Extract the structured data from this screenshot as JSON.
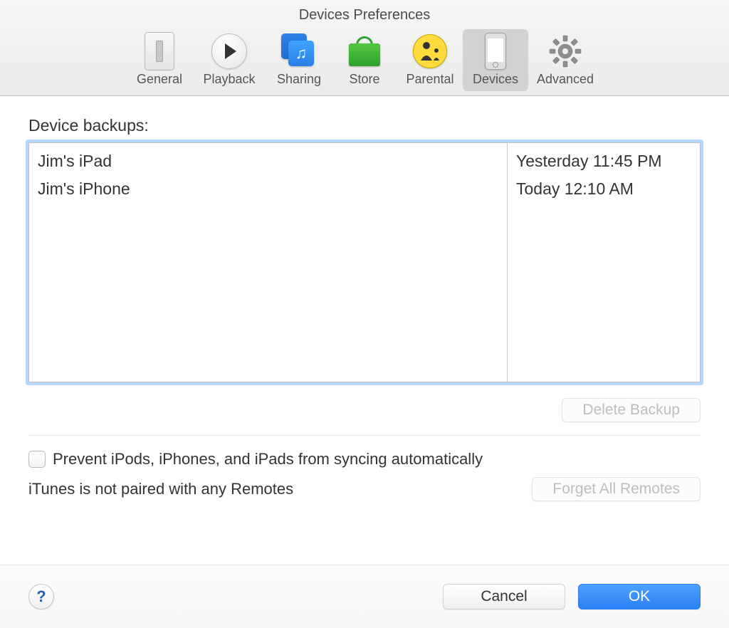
{
  "window": {
    "title": "Devices Preferences"
  },
  "toolbar": {
    "items": [
      {
        "id": "general",
        "label": "General"
      },
      {
        "id": "playback",
        "label": "Playback"
      },
      {
        "id": "sharing",
        "label": "Sharing"
      },
      {
        "id": "store",
        "label": "Store"
      },
      {
        "id": "parental",
        "label": "Parental"
      },
      {
        "id": "devices",
        "label": "Devices"
      },
      {
        "id": "advanced",
        "label": "Advanced"
      }
    ],
    "selected": "devices"
  },
  "backups": {
    "section_label": "Device backups:",
    "rows": [
      {
        "name": "Jim's iPad",
        "time": "Yesterday 11:45 PM"
      },
      {
        "name": "Jim's iPhone",
        "time": "Today 12:10 AM"
      }
    ],
    "delete_button": "Delete Backup"
  },
  "options": {
    "prevent_sync_label": "Prevent iPods, iPhones, and iPads from syncing automatically",
    "prevent_sync_checked": false,
    "remotes_status": "iTunes is not paired with any Remotes",
    "forget_all_button": "Forget All Remotes"
  },
  "footer": {
    "help_glyph": "?",
    "cancel": "Cancel",
    "ok": "OK"
  }
}
